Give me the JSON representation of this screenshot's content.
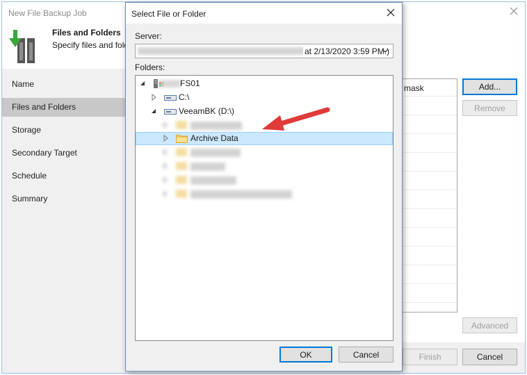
{
  "wizard": {
    "title": "New File Backup Job",
    "header_title": "Files and Folders",
    "header_subtitle": "Specify files and fold",
    "nav": [
      {
        "label": "Name",
        "active": false
      },
      {
        "label": "Files and Folders",
        "active": true
      },
      {
        "label": "Storage",
        "active": false
      },
      {
        "label": "Secondary Target",
        "active": false
      },
      {
        "label": "Schedule",
        "active": false
      },
      {
        "label": "Summary",
        "active": false
      }
    ],
    "table_header": "mask",
    "buttons": {
      "add": "Add...",
      "remove": "Remove",
      "advanced": "Advanced",
      "finish": "Finish",
      "cancel": "Cancel"
    }
  },
  "dialog": {
    "title": "Select File or Folder",
    "server_label": "Server:",
    "server_value": "at 2/13/2020 3:59 PM.)",
    "folders_label": "Folders:",
    "tree": {
      "root": "FS01",
      "drive_c": "C:\\",
      "drive_d": "VeeamBK (D:\\)",
      "selected_folder": "Archive Data"
    },
    "ok_label": "OK",
    "cancel_label": "Cancel"
  },
  "colors": {
    "selection": "#cce8ff",
    "accent_border": "#0078d7",
    "annotation_arrow": "#e03a3a",
    "nav_active": "#c8c8c8"
  }
}
